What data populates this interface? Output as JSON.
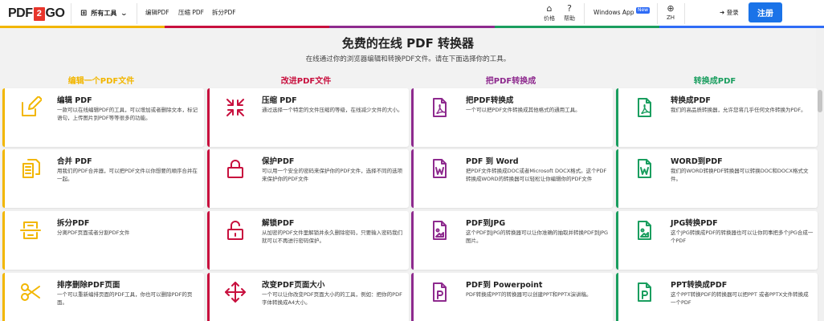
{
  "header": {
    "logo": {
      "left": "PDF",
      "mid": "2",
      "right": "GO"
    },
    "all_tools": "所有工具",
    "nav": [
      "编辑PDF",
      "压缩 PDF",
      "拆分PDF"
    ],
    "pricing": "价格",
    "help": "帮助",
    "windows_app": "Windows App",
    "new_badge": "New",
    "lang": "ZH",
    "login": "登录",
    "signup": "注册"
  },
  "stripe_colors": [
    "#f2b600",
    "#c8103e",
    "#8e2a8e",
    "#1a9e5f",
    "#2f6cf6"
  ],
  "hero": {
    "title": "免费的在线 PDF 转换器",
    "subtitle": "在线通过你的浏览器编辑和转换PDF文件。请在下面选择你的工具。"
  },
  "columns": [
    {
      "heading": "编辑一个PDF文件",
      "color": "#f2b600",
      "cards": [
        {
          "icon": "edit-icon",
          "title": "编辑 PDF",
          "desc": "一款可以在线编辑PDF的工具，可以增加或者删除文本，标记语句，上传图片到PDF等等很多的功能。"
        },
        {
          "icon": "merge-icon",
          "title": "合并 PDF",
          "desc": "用我们的PDF合并器，可以把PDF文件以你想要的顺序合并在一起。"
        },
        {
          "icon": "split-icon",
          "title": "拆分PDF",
          "desc": "分离PDF页面或者分割PDF文件"
        },
        {
          "icon": "scissors-icon",
          "title": "排序删除PDF页面",
          "desc": "一个可以重新编排页面的PDF工具，你也可以删除PDF的页面。"
        }
      ]
    },
    {
      "heading": "改进PDF文件",
      "color": "#c8103e",
      "cards": [
        {
          "icon": "compress-icon",
          "title": "压缩 PDF",
          "desc": "通过选择一个特定的文件压缩的等级，在线减少文件的大小。"
        },
        {
          "icon": "lock-icon",
          "title": "保护PDF",
          "desc": "可以用一个安全的密码来保护你的PDF文件，选择不同的选项来保护你的PDF文件"
        },
        {
          "icon": "unlock-icon",
          "title": "解锁PDF",
          "desc": "从加密的PDF文件里解锁并永久删除密码，只要输入密码我们就可以不再进行密码保护。"
        },
        {
          "icon": "resize-icon",
          "title": "改变PDF页面大小",
          "desc": "一个可以让你改变PDF页面大小的的工具，例如：把你的PDF字体转换成A4大小。"
        }
      ]
    },
    {
      "heading": "把PDF转换成",
      "color": "#8e2a8e",
      "cards": [
        {
          "icon": "pdf-file-icon",
          "title": "把PDF转换成",
          "desc": "一个可以把PDF文件转换成其他格式的通用工具。"
        },
        {
          "icon": "word-file-icon",
          "title": "PDF 到 Word",
          "desc": "把PDF文件转换成DOC或者Microsoft DOCX格式。这个PDF转换成WORD的转换器可以轻松让你编辑你的PDF文件"
        },
        {
          "icon": "image-file-icon",
          "title": "PDF到JPG",
          "desc": "这个PDF到JPG的转换器可以让你准确的抽取并转换PDF到JPG图片。"
        },
        {
          "icon": "powerpoint-file-icon",
          "title": "PDF到 Powerpoint",
          "desc": "PDF转换成PPT的转换器可以创建PPT和PPTX演讲稿。"
        }
      ]
    },
    {
      "heading": "转换成PDF",
      "color": "#1a9e5f",
      "cards": [
        {
          "icon": "pdf-file-icon",
          "title": "转换成PDF",
          "desc": "我们的高品质转换器，允许您将几乎任何文件转换为PDF。"
        },
        {
          "icon": "word-file-icon",
          "title": "WORD到PDF",
          "desc": "我们的WORD转换PDF转换器可以转换DOC和DOCX格式文件。"
        },
        {
          "icon": "image-file-icon",
          "title": "JPG转换PDF",
          "desc": "这个JPG转换成PDF的转换器也可以让你同事把多个JPG合成一个PDF"
        },
        {
          "icon": "powerpoint-file-icon",
          "title": "PPT转换成PDF",
          "desc": "这个PPT转换PDF的转换器可以把PPT 或者PPTX文件转换成一个PDF"
        }
      ]
    }
  ]
}
